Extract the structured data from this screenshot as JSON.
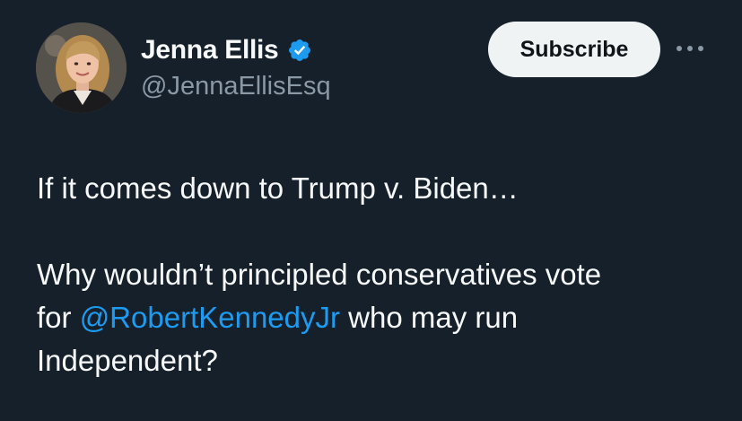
{
  "author": {
    "display_name": "Jenna Ellis",
    "handle": "@JennaEllisEsq",
    "verified_icon": "verified-badge-icon",
    "verified_color": "#1d9bf0"
  },
  "actions": {
    "subscribe_label": "Subscribe",
    "more_icon": "more-horizontal-icon"
  },
  "tweet": {
    "line1": "If it comes down to Trump v. Biden…",
    "line2": "Why wouldn’t principled conservatives vote",
    "line3_prefix": "for ",
    "mention": "@RobertKennedyJr",
    "line3_suffix": " who may run",
    "line4": "Independent?"
  },
  "colors": {
    "background": "#15202b",
    "text": "#f7f9f9",
    "secondary_text": "#8b98a5",
    "link": "#1d9bf0",
    "button_bg": "#eff3f4"
  }
}
